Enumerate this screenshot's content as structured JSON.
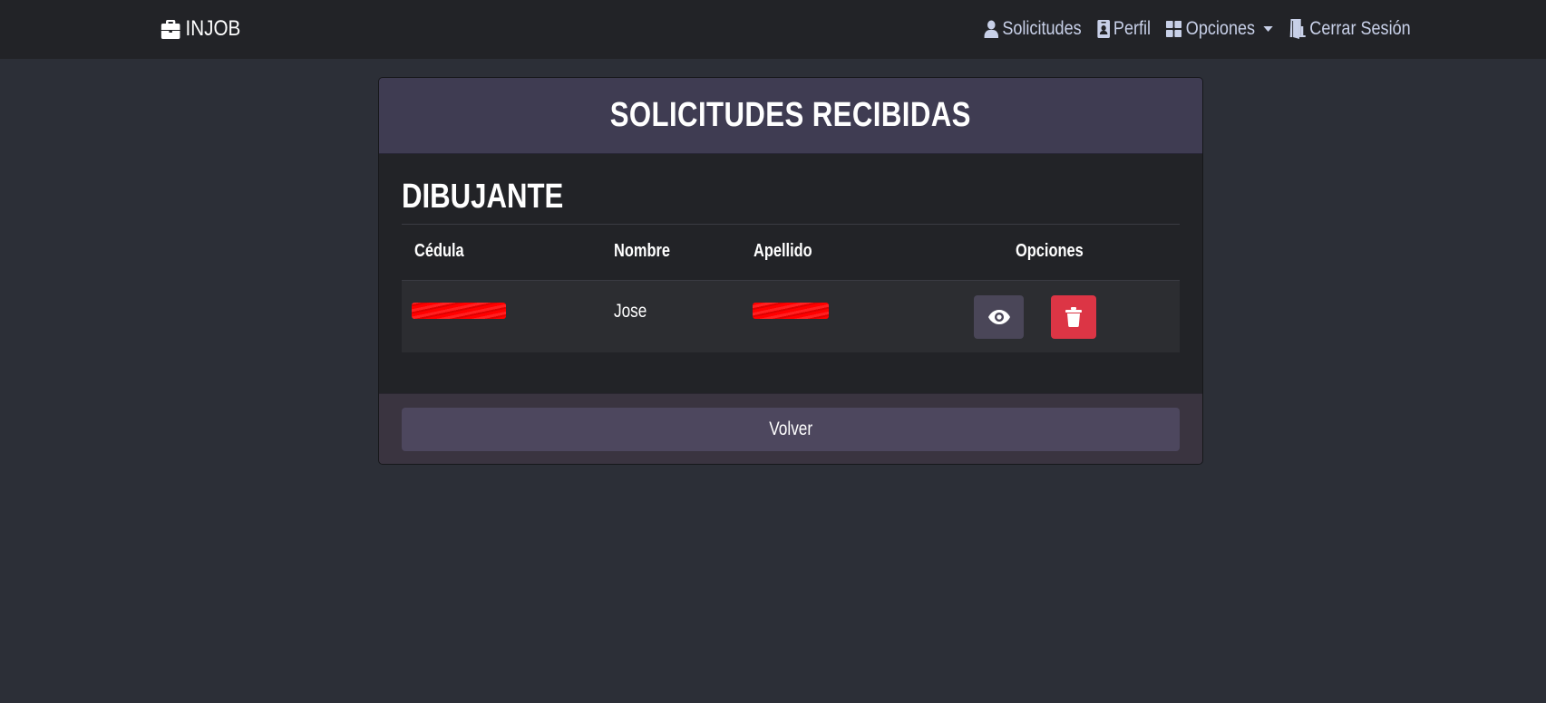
{
  "navbar": {
    "brand": "INJOB",
    "links": {
      "solicitudes": "Solicitudes",
      "perfil": "Perfil",
      "opciones": "Opciones",
      "cerrar_sesion": "Cerrar Sesión"
    }
  },
  "card": {
    "title": "SOLICITUDES RECIBIDAS",
    "section_title": "DIBUJANTE",
    "table": {
      "headers": {
        "cedula": "Cédula",
        "nombre": "Nombre",
        "apellido": "Apellido",
        "opciones": "Opciones"
      },
      "rows": [
        {
          "cedula": "",
          "nombre": "Jose",
          "apellido": ""
        }
      ]
    },
    "footer": {
      "back_label": "Volver"
    }
  },
  "colors": {
    "navbar_bg": "#222327",
    "page_bg": "#2c2f37",
    "card_header_bg": "#3f3c52",
    "view_button_bg": "#4a4658",
    "delete_button_bg": "#dc3545",
    "back_button_bg": "#4d475e",
    "nav_link_color": "#c8d0e8"
  },
  "icons": {
    "brand": "briefcase-icon",
    "solicitudes": "user-icon",
    "perfil": "id-badge-icon",
    "opciones": "grid-icon",
    "cerrar_sesion": "door-exit-icon",
    "view": "eye-icon",
    "delete": "trash-icon"
  }
}
